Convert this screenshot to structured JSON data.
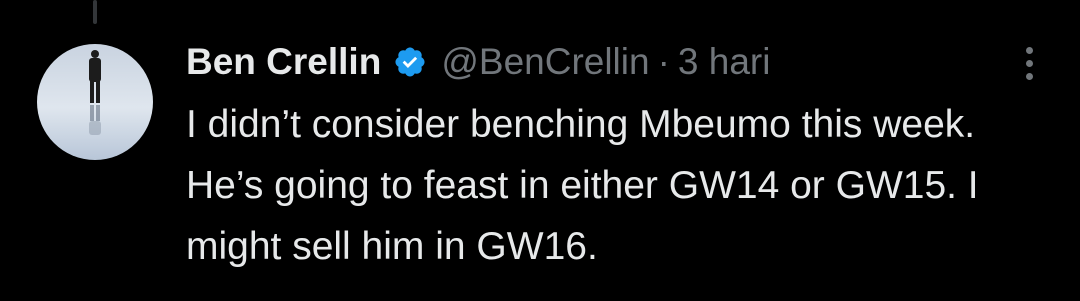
{
  "tweet": {
    "author": {
      "display_name": "Ben Crellin",
      "handle": "@BenCrellin",
      "verified": true
    },
    "separator": "·",
    "time": "3 hari",
    "text": "I didn’t consider benching Mbeumo this week. He’s going to feast in either GW14 or GW15. I might sell him in GW16."
  },
  "colors": {
    "background": "#000000",
    "primary_text": "#e7e9ea",
    "secondary_text": "#71767b",
    "verified_badge": "#1d9bf0"
  },
  "icons": {
    "verified": "verified-badge-icon",
    "more": "more-options-icon"
  }
}
